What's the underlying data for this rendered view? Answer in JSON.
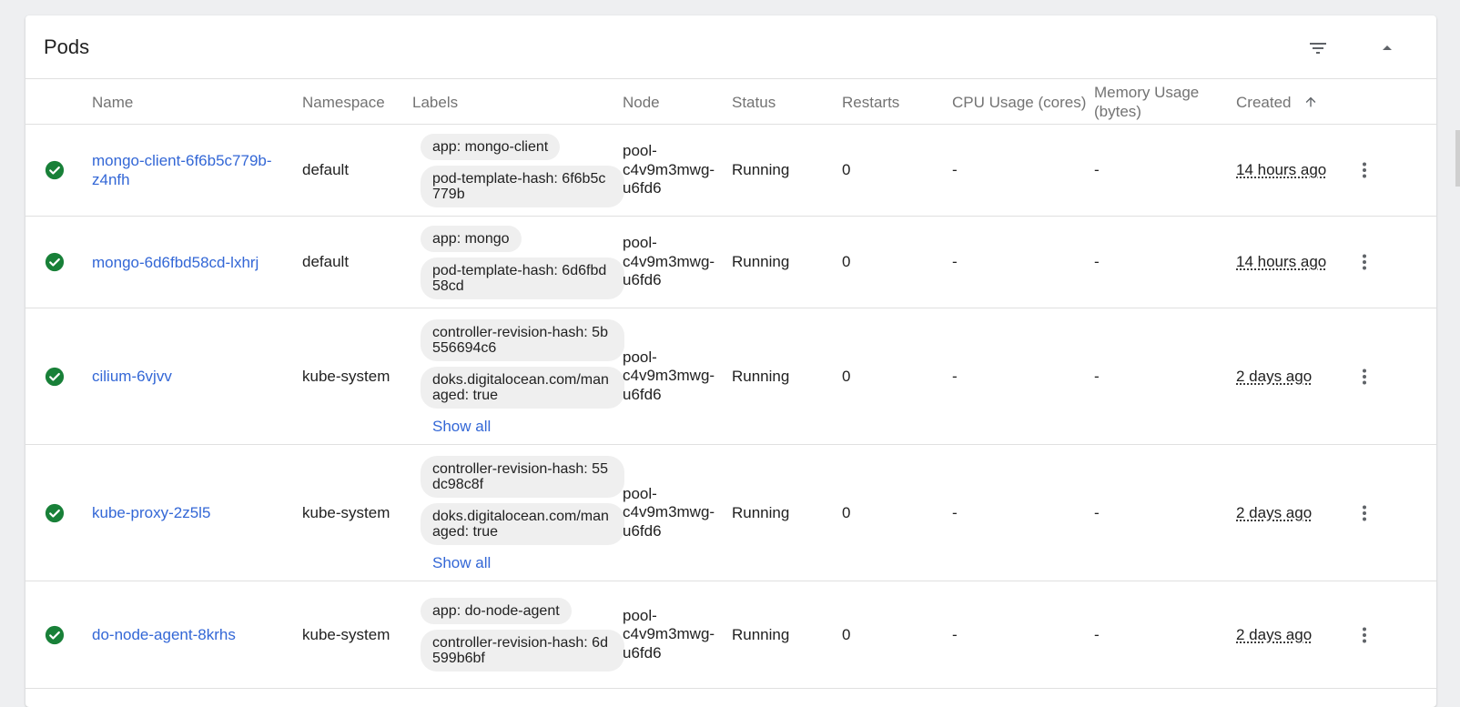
{
  "card": {
    "title": "Pods"
  },
  "columns": {
    "name": "Name",
    "namespace": "Namespace",
    "labels": "Labels",
    "node": "Node",
    "status": "Status",
    "restarts": "Restarts",
    "cpu": "CPU Usage (cores)",
    "memory_line1": "Memory Usage",
    "memory_line2": "(bytes)",
    "created": "Created"
  },
  "show_all_label": "Show all",
  "status_color": "#188038",
  "link_color": "#3367d6",
  "rows": [
    {
      "name": "mongo-client-6f6b5c779b-z4nfh",
      "namespace": "default",
      "labels": [
        "app: mongo-client",
        "pod-template-hash: 6f6b5c779b"
      ],
      "node": "pool-c4v9m3mwg-u6fd6",
      "status": "Running",
      "restarts": "0",
      "cpu": "-",
      "memory": "-",
      "created": "14 hours ago"
    },
    {
      "name": "mongo-6d6fbd58cd-lxhrj",
      "namespace": "default",
      "labels": [
        "app: mongo",
        "pod-template-hash: 6d6fbd58cd"
      ],
      "node": "pool-c4v9m3mwg-u6fd6",
      "status": "Running",
      "restarts": "0",
      "cpu": "-",
      "memory": "-",
      "created": "14 hours ago"
    },
    {
      "name": "cilium-6vjvv",
      "namespace": "kube-system",
      "labels": [
        "controller-revision-hash: 5b556694c6",
        "doks.digitalocean.com/managed: true"
      ],
      "node": "pool-c4v9m3mwg-u6fd6",
      "status": "Running",
      "restarts": "0",
      "cpu": "-",
      "memory": "-",
      "created": "2 days ago"
    },
    {
      "name": "kube-proxy-2z5l5",
      "namespace": "kube-system",
      "labels": [
        "controller-revision-hash: 55dc98c8f",
        "doks.digitalocean.com/managed: true"
      ],
      "node": "pool-c4v9m3mwg-u6fd6",
      "status": "Running",
      "restarts": "0",
      "cpu": "-",
      "memory": "-",
      "created": "2 days ago"
    },
    {
      "name": "do-node-agent-8krhs",
      "namespace": "kube-system",
      "labels": [
        "app: do-node-agent",
        "controller-revision-hash: 6d599b6bf"
      ],
      "node": "pool-c4v9m3mwg-u6fd6",
      "status": "Running",
      "restarts": "0",
      "cpu": "-",
      "memory": "-",
      "created": "2 days ago"
    }
  ]
}
